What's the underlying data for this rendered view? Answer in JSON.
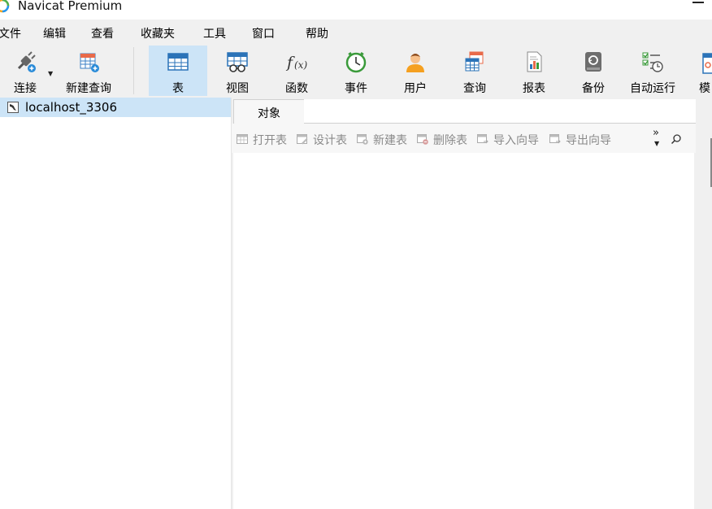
{
  "window": {
    "title": "Navicat Premium"
  },
  "menu": {
    "items": [
      "文件",
      "编辑",
      "查看",
      "收藏夹",
      "工具",
      "窗口",
      "帮助"
    ]
  },
  "toolbar": {
    "buttons": [
      {
        "label": "连接",
        "icon": "plug-icon"
      },
      {
        "label": "新建查询",
        "icon": "new-query-icon"
      },
      {
        "label": "表",
        "icon": "table-icon",
        "active": true
      },
      {
        "label": "视图",
        "icon": "view-icon"
      },
      {
        "label": "函数",
        "icon": "function-icon"
      },
      {
        "label": "事件",
        "icon": "clock-icon"
      },
      {
        "label": "用户",
        "icon": "user-icon"
      },
      {
        "label": "查询",
        "icon": "query-icon"
      },
      {
        "label": "报表",
        "icon": "report-icon"
      },
      {
        "label": "备份",
        "icon": "backup-icon"
      },
      {
        "label": "自动运行",
        "icon": "schedule-icon"
      },
      {
        "label": "模",
        "icon": "model-icon"
      }
    ]
  },
  "nav": {
    "connections": [
      {
        "label": "localhost_3306",
        "icon": "mysql-connection-icon",
        "selected": true
      }
    ]
  },
  "content": {
    "tab_label": "对象",
    "object_toolbar": [
      "打开表",
      "设计表",
      "新建表",
      "删除表",
      "导入向导",
      "导出向导"
    ],
    "more_label": "»"
  },
  "colors": {
    "accent": "#cce4f7",
    "toolbar_bg": "#f0f0f0",
    "disabled_text": "#8a8a8a"
  }
}
